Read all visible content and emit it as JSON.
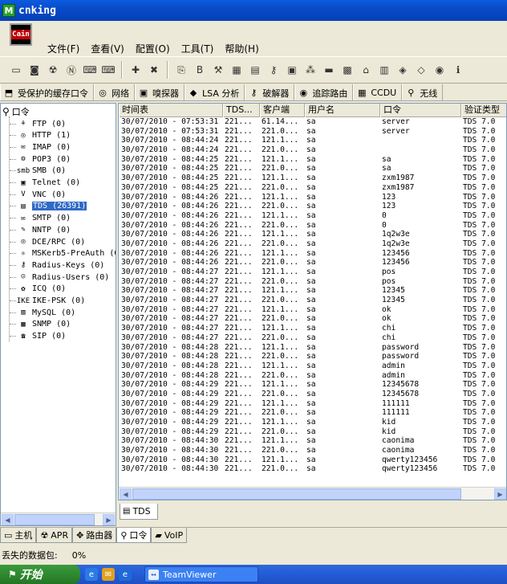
{
  "window": {
    "title": "cnking",
    "icon_letter": "M",
    "logo_text": "Cain"
  },
  "menu": [
    {
      "label": "文件(F)"
    },
    {
      "label": "查看(V)"
    },
    {
      "label": "配置(O)"
    },
    {
      "label": "工具(T)"
    },
    {
      "label": "帮助(H)"
    }
  ],
  "toolbar": [
    {
      "icon": "folder-icon",
      "glyph": "▭"
    },
    {
      "icon": "capture-icon",
      "glyph": "◙"
    },
    {
      "icon": "radiation-icon",
      "glyph": "☢"
    },
    {
      "icon": "ntlm-auth-icon",
      "glyph": "Ⓝ"
    },
    {
      "icon": "chall-spoof-reset-icon",
      "glyph": "⌨"
    },
    {
      "icon": "chall-spoof-ntlm-icon",
      "glyph": "⌨"
    },
    {
      "sep": true
    },
    {
      "icon": "add-icon",
      "glyph": "✚"
    },
    {
      "icon": "remove-icon",
      "glyph": "✖"
    },
    {
      "sep": true
    },
    {
      "icon": "decode-icon",
      "glyph": "⎘"
    },
    {
      "icon": "base64-icon",
      "glyph": "B"
    },
    {
      "icon": "tool-icon",
      "glyph": "⚒"
    },
    {
      "icon": "ntlm-icon",
      "glyph": "▦"
    },
    {
      "icon": "mpp-icon",
      "glyph": "▤"
    },
    {
      "icon": "key-icon",
      "glyph": "⚷"
    },
    {
      "icon": "cert-icon",
      "glyph": "▣"
    },
    {
      "icon": "password-icon",
      "glyph": "⁂"
    },
    {
      "icon": "monitor-icon",
      "glyph": "▬"
    },
    {
      "icon": "grid-icon",
      "glyph": "▩"
    },
    {
      "icon": "house-icon",
      "glyph": "⌂"
    },
    {
      "icon": "network-icon",
      "glyph": "▥"
    },
    {
      "icon": "chip-icon",
      "glyph": "◈"
    },
    {
      "icon": "sign-icon",
      "glyph": "◇"
    },
    {
      "icon": "lock-icon",
      "glyph": "◉"
    },
    {
      "icon": "info-icon",
      "glyph": "ℹ"
    }
  ],
  "tabs": [
    {
      "label": "受保护的缓存口令",
      "icon": "cache-icon",
      "glyph": "⬒"
    },
    {
      "label": "网络",
      "icon": "network-icon",
      "glyph": "◎"
    },
    {
      "label": "嗅探器",
      "icon": "sniffer-icon",
      "glyph": "▣"
    },
    {
      "label": "LSA 分析",
      "icon": "lsa-icon",
      "glyph": "◆"
    },
    {
      "label": "破解器",
      "icon": "cracker-icon",
      "glyph": "⚷"
    },
    {
      "label": "追踪路由",
      "icon": "traceroute-icon",
      "glyph": "◉"
    },
    {
      "label": "CCDU",
      "icon": "ccdu-icon",
      "glyph": "▦"
    },
    {
      "label": "无线",
      "icon": "wireless-icon",
      "glyph": "⚲"
    }
  ],
  "tree": {
    "root": "口令",
    "items": [
      {
        "label": "FTP (0)",
        "icon": "ftp-icon",
        "glyph": "⚘"
      },
      {
        "label": "HTTP (1)",
        "icon": "http-icon",
        "glyph": "◎"
      },
      {
        "label": "IMAP (0)",
        "icon": "imap-icon",
        "glyph": "✉"
      },
      {
        "label": "POP3 (0)",
        "icon": "pop3-icon",
        "glyph": "⚙"
      },
      {
        "label": "SMB (0)",
        "icon": "smb-icon",
        "glyph": "smb"
      },
      {
        "label": "Telnet (0)",
        "icon": "telnet-icon",
        "glyph": "▣"
      },
      {
        "label": "VNC (0)",
        "icon": "vnc-icon",
        "glyph": "V"
      },
      {
        "label": "TDS (26391)",
        "icon": "tds-icon",
        "glyph": "▤",
        "selected": true
      },
      {
        "label": "SMTP (0)",
        "icon": "smtp-icon",
        "glyph": "✉"
      },
      {
        "label": "NNTP (0)",
        "icon": "nntp-icon",
        "glyph": "✎"
      },
      {
        "label": "DCE/RPC (0)",
        "icon": "dcerpc-icon",
        "glyph": "◎"
      },
      {
        "label": "MSKerb5-PreAuth (0)",
        "icon": "kerberos-icon",
        "glyph": "⚛"
      },
      {
        "label": "Radius-Keys (0)",
        "icon": "radius-keys-icon",
        "glyph": "⚷"
      },
      {
        "label": "Radius-Users (0)",
        "icon": "radius-users-icon",
        "glyph": "☺"
      },
      {
        "label": "ICQ (0)",
        "icon": "icq-icon",
        "glyph": "✿"
      },
      {
        "label": "IKE-PSK (0)",
        "icon": "ike-icon",
        "glyph": "IKE"
      },
      {
        "label": "MySQL (0)",
        "icon": "mysql-icon",
        "glyph": "▥"
      },
      {
        "label": "SNMP (0)",
        "icon": "snmp-icon",
        "glyph": "▦"
      },
      {
        "label": "SIP (0)",
        "icon": "sip-icon",
        "glyph": "☎"
      }
    ]
  },
  "grid": {
    "headers": [
      "时间表",
      "TDS...",
      "客户端",
      "用户名",
      "口令",
      "验证类型"
    ],
    "rows": [
      [
        "30/07/2010 - 07:53:31",
        "221...",
        "61.14...",
        "sa",
        "server",
        "TDS 7.0"
      ],
      [
        "30/07/2010 - 07:53:31",
        "221...",
        "221.0...",
        "sa",
        "server",
        "TDS 7.0"
      ],
      [
        "30/07/2010 - 08:44:24",
        "221...",
        "121.1...",
        "sa",
        "",
        "TDS 7.0"
      ],
      [
        "30/07/2010 - 08:44:24",
        "221...",
        "221.0...",
        "sa",
        "",
        "TDS 7.0"
      ],
      [
        "30/07/2010 - 08:44:25",
        "221...",
        "121.1...",
        "sa",
        "sa",
        "TDS 7.0"
      ],
      [
        "30/07/2010 - 08:44:25",
        "221...",
        "221.0...",
        "sa",
        "sa",
        "TDS 7.0"
      ],
      [
        "30/07/2010 - 08:44:25",
        "221...",
        "121.1...",
        "sa",
        "zxm1987",
        "TDS 7.0"
      ],
      [
        "30/07/2010 - 08:44:25",
        "221...",
        "221.0...",
        "sa",
        "zxm1987",
        "TDS 7.0"
      ],
      [
        "30/07/2010 - 08:44:26",
        "221...",
        "121.1...",
        "sa",
        "123",
        "TDS 7.0"
      ],
      [
        "30/07/2010 - 08:44:26",
        "221...",
        "221.0...",
        "sa",
        "123",
        "TDS 7.0"
      ],
      [
        "30/07/2010 - 08:44:26",
        "221...",
        "121.1...",
        "sa",
        "0",
        "TDS 7.0"
      ],
      [
        "30/07/2010 - 08:44:26",
        "221...",
        "221.0...",
        "sa",
        "0",
        "TDS 7.0"
      ],
      [
        "30/07/2010 - 08:44:26",
        "221...",
        "121.1...",
        "sa",
        "1q2w3e",
        "TDS 7.0"
      ],
      [
        "30/07/2010 - 08:44:26",
        "221...",
        "221.0...",
        "sa",
        "1q2w3e",
        "TDS 7.0"
      ],
      [
        "30/07/2010 - 08:44:26",
        "221...",
        "121.1...",
        "sa",
        "123456",
        "TDS 7.0"
      ],
      [
        "30/07/2010 - 08:44:26",
        "221...",
        "221.0...",
        "sa",
        "123456",
        "TDS 7.0"
      ],
      [
        "30/07/2010 - 08:44:27",
        "221...",
        "121.1...",
        "sa",
        "pos",
        "TDS 7.0"
      ],
      [
        "30/07/2010 - 08:44:27",
        "221...",
        "221.0...",
        "sa",
        "pos",
        "TDS 7.0"
      ],
      [
        "30/07/2010 - 08:44:27",
        "221...",
        "121.1...",
        "sa",
        "12345",
        "TDS 7.0"
      ],
      [
        "30/07/2010 - 08:44:27",
        "221...",
        "221.0...",
        "sa",
        "12345",
        "TDS 7.0"
      ],
      [
        "30/07/2010 - 08:44:27",
        "221...",
        "121.1...",
        "sa",
        "ok",
        "TDS 7.0"
      ],
      [
        "30/07/2010 - 08:44:27",
        "221...",
        "221.0...",
        "sa",
        "ok",
        "TDS 7.0"
      ],
      [
        "30/07/2010 - 08:44:27",
        "221...",
        "121.1...",
        "sa",
        "chi",
        "TDS 7.0"
      ],
      [
        "30/07/2010 - 08:44:27",
        "221...",
        "221.0...",
        "sa",
        "chi",
        "TDS 7.0"
      ],
      [
        "30/07/2010 - 08:44:28",
        "221...",
        "121.1...",
        "sa",
        "password",
        "TDS 7.0"
      ],
      [
        "30/07/2010 - 08:44:28",
        "221...",
        "221.0...",
        "sa",
        "password",
        "TDS 7.0"
      ],
      [
        "30/07/2010 - 08:44:28",
        "221...",
        "121.1...",
        "sa",
        "admin",
        "TDS 7.0"
      ],
      [
        "30/07/2010 - 08:44:28",
        "221...",
        "221.0...",
        "sa",
        "admin",
        "TDS 7.0"
      ],
      [
        "30/07/2010 - 08:44:29",
        "221...",
        "121.1...",
        "sa",
        "12345678",
        "TDS 7.0"
      ],
      [
        "30/07/2010 - 08:44:29",
        "221...",
        "221.0...",
        "sa",
        "12345678",
        "TDS 7.0"
      ],
      [
        "30/07/2010 - 08:44:29",
        "221...",
        "121.1...",
        "sa",
        "111111",
        "TDS 7.0"
      ],
      [
        "30/07/2010 - 08:44:29",
        "221...",
        "221.0...",
        "sa",
        "111111",
        "TDS 7.0"
      ],
      [
        "30/07/2010 - 08:44:29",
        "221...",
        "121.1...",
        "sa",
        "kid",
        "TDS 7.0"
      ],
      [
        "30/07/2010 - 08:44:29",
        "221...",
        "221.0...",
        "sa",
        "kid",
        "TDS 7.0"
      ],
      [
        "30/07/2010 - 08:44:30",
        "221...",
        "121.1...",
        "sa",
        "caonima",
        "TDS 7.0"
      ],
      [
        "30/07/2010 - 08:44:30",
        "221...",
        "221.0...",
        "sa",
        "caonima",
        "TDS 7.0"
      ],
      [
        "30/07/2010 - 08:44:30",
        "221...",
        "121.1...",
        "sa",
        "qwerty123456",
        "TDS 7.0"
      ],
      [
        "30/07/2010 - 08:44:30",
        "221...",
        "221.0...",
        "sa",
        "qwerty123456",
        "TDS 7.0"
      ]
    ]
  },
  "subtab": {
    "label": "TDS",
    "icon": "tds-icon"
  },
  "bottom_tabs": [
    {
      "label": "主机",
      "icon": "host-icon",
      "glyph": "▭"
    },
    {
      "label": "APR",
      "icon": "apr-icon",
      "glyph": "☢"
    },
    {
      "label": "路由器",
      "icon": "router-icon",
      "glyph": "✥"
    },
    {
      "label": "口令",
      "icon": "password-icon",
      "glyph": "⚲",
      "active": true
    },
    {
      "label": "VoIP",
      "icon": "voip-icon",
      "glyph": "▰"
    }
  ],
  "status": {
    "label": "丢失的数据包:",
    "value": "0%"
  },
  "taskbar": {
    "start_label": "开始",
    "quick_launch": [
      {
        "icon": "ie-icon",
        "glyph": "e",
        "color": "#2a7be4"
      },
      {
        "icon": "outlook-icon",
        "glyph": "✉",
        "color": "#e0a020"
      },
      {
        "icon": "ie2-icon",
        "glyph": "e",
        "color": "#1f6ad8"
      }
    ],
    "task_label": "TeamViewer"
  },
  "colors": {
    "title_blue": "#0a4bc8",
    "selection": "#316ac5",
    "start_green": "#2f8a2f"
  }
}
